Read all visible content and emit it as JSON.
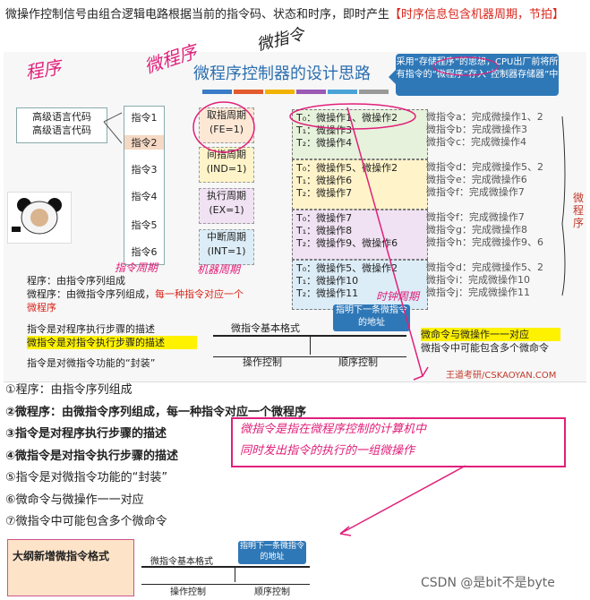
{
  "top_note": {
    "text": "微操作控制信号由组合逻辑电路根据当前的指令码、状态和时序，即时产生",
    "highlight": "【时序信息包含机器周期，节拍】"
  },
  "slide": {
    "title": "微程序控制器的设计思路",
    "callout": "采用“存储程序”的思想，CPU出厂前将所有指令的“微程序”存入“控制器存储器”中",
    "lang_box": [
      "高级语言代码",
      "高级语言代码"
    ],
    "instructions": [
      "指令1",
      "指令2",
      "指令3",
      "指令4",
      "指令5",
      "指令6"
    ],
    "cycles": [
      {
        "name": "取指周期",
        "code": "(FE=1)"
      },
      {
        "name": "间指周期",
        "code": "(IND=1)"
      },
      {
        "name": "执行周期",
        "code": "(EX=1)"
      },
      {
        "name": "中断周期",
        "code": "(INT=1)"
      }
    ],
    "groups": [
      [
        "T₀：微操作1、微操作2",
        "T₁：微操作3",
        "T₂：微操作4"
      ],
      [
        "T₀：微操作5、微操作2",
        "T₁：微操作6",
        "T₂：微操作7"
      ],
      [
        "T₀：微操作7",
        "T₁：微操作8",
        "T₂：微操作9、微操作6"
      ],
      [
        "T₀：微操作5、微操作2",
        "T₁：微操作10",
        "T₂：微操作11"
      ]
    ],
    "micro_instr": [
      [
        "微指令a：完成微操作1、2",
        "微指令b：完成微操作3",
        "微指令c：完成微操作4"
      ],
      [
        "微指令d：完成微操作5、2",
        "微指令e：完成微操作6",
        "微指令f：完成微操作7"
      ],
      [
        "微指令f：完成微操作7",
        "微指令g：完成微操作8",
        "微指令h：完成微操作9、6"
      ],
      [
        "微指令d：完成微操作5、2",
        "微指令i：完成微操作10",
        "微指令j：完成微操作11"
      ]
    ],
    "vert_label": "微程序",
    "prog_lines": [
      "程序：由指令序列组成",
      "微程序：由微指令序列组成，",
      "每一种指令对应一个微程序"
    ],
    "desc_lines": [
      "指令是对程序执行步骤的描述",
      "微指令是对指令执行步骤的描述",
      "指令是对微指令功能的“封装”"
    ],
    "format_title": "微指令基本格式",
    "format_ops": "操作控制",
    "format_seq": "顺序控制",
    "format_callout": "指明下一条微指令的地址",
    "right_note": [
      "微命令与微操作一一对应",
      "微指令中可能包含多个微命令"
    ],
    "brand": "王道考研/CSKAOYAN.COM"
  },
  "handwriting": {
    "program": "程序",
    "microprogram": "微程序",
    "microinstr": "微指令",
    "instr_cycle": "指令周期",
    "machine_cycle": "机器周期",
    "clock_cycle": "时钟周期",
    "box": [
      "微指令是指在微程序控制的计算机中",
      "同时发出指令的执行的一组微操作"
    ]
  },
  "list": [
    "①程序：由指令序列组成",
    "②微程序：由微指令序列组成，每一种指令对应一个微程序",
    "③指令是对程序执行步骤的描述",
    "④微指令是对指令执行步骤的描述",
    "⑤指令是对微指令功能的“封装”",
    "⑥微命令与微操作一一对应",
    "⑦微指令中可能包含多个微命令"
  ],
  "bottom": {
    "title": "大纲新增微指令格式",
    "format_title": "微指令基本格式",
    "callout": "指明下一条微指令的地址",
    "ops": "操作控制",
    "seq": "顺序控制"
  },
  "watermark": "CSDN @是bit不是byte"
}
